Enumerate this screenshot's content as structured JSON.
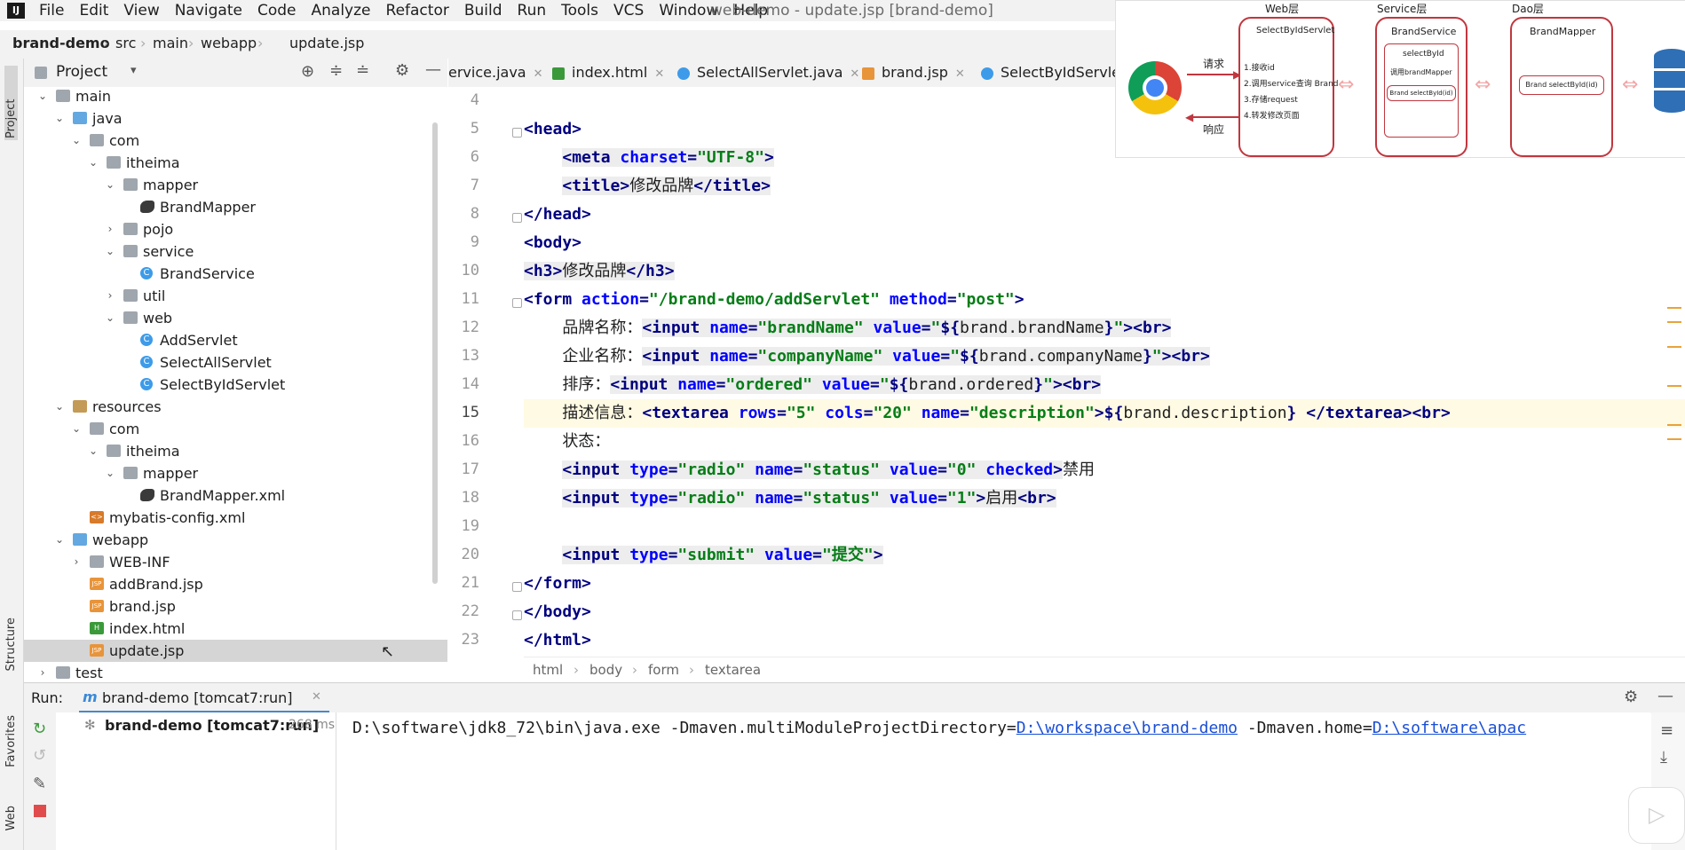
{
  "menu": {
    "items": [
      "File",
      "Edit",
      "View",
      "Navigate",
      "Code",
      "Analyze",
      "Refactor",
      "Build",
      "Run",
      "Tools",
      "VCS",
      "Window",
      "Help"
    ],
    "window_title": "web-demo - update.jsp [brand-demo]"
  },
  "breadcrumb": [
    "brand-demo",
    "src",
    "main",
    "webapp",
    "update.jsp"
  ],
  "left_stripe": {
    "project": "Project",
    "structure": "Structure",
    "favorites": "Favorites",
    "web": "Web"
  },
  "project_panel": {
    "title": "Project"
  },
  "tree": [
    {
      "label": "main",
      "depth": 3,
      "arrow": "down",
      "icon": "folder"
    },
    {
      "label": "java",
      "depth": 4,
      "arrow": "down",
      "icon": "folder-blue"
    },
    {
      "label": "com",
      "depth": 5,
      "arrow": "down",
      "icon": "folder"
    },
    {
      "label": "itheima",
      "depth": 6,
      "arrow": "down",
      "icon": "folder"
    },
    {
      "label": "mapper",
      "depth": 7,
      "arrow": "down",
      "icon": "folder"
    },
    {
      "label": "BrandMapper",
      "depth": 8,
      "arrow": "",
      "icon": "mybatis"
    },
    {
      "label": "pojo",
      "depth": 7,
      "arrow": "right",
      "icon": "folder"
    },
    {
      "label": "service",
      "depth": 7,
      "arrow": "down",
      "icon": "folder"
    },
    {
      "label": "BrandService",
      "depth": 8,
      "arrow": "",
      "icon": "class"
    },
    {
      "label": "util",
      "depth": 7,
      "arrow": "right",
      "icon": "folder"
    },
    {
      "label": "web",
      "depth": 7,
      "arrow": "down",
      "icon": "folder"
    },
    {
      "label": "AddServlet",
      "depth": 8,
      "arrow": "",
      "icon": "class"
    },
    {
      "label": "SelectAllServlet",
      "depth": 8,
      "arrow": "",
      "icon": "class"
    },
    {
      "label": "SelectByIdServlet",
      "depth": 8,
      "arrow": "",
      "icon": "class"
    },
    {
      "label": "resources",
      "depth": 4,
      "arrow": "down",
      "icon": "folder-res"
    },
    {
      "label": "com",
      "depth": 5,
      "arrow": "down",
      "icon": "folder"
    },
    {
      "label": "itheima",
      "depth": 6,
      "arrow": "down",
      "icon": "folder"
    },
    {
      "label": "mapper",
      "depth": 7,
      "arrow": "down",
      "icon": "folder"
    },
    {
      "label": "BrandMapper.xml",
      "depth": 8,
      "arrow": "",
      "icon": "mybatis"
    },
    {
      "label": "mybatis-config.xml",
      "depth": 5,
      "arrow": "",
      "icon": "xml"
    },
    {
      "label": "webapp",
      "depth": 4,
      "arrow": "down",
      "icon": "folder-blue"
    },
    {
      "label": "WEB-INF",
      "depth": 5,
      "arrow": "right",
      "icon": "folder"
    },
    {
      "label": "addBrand.jsp",
      "depth": 5,
      "arrow": "",
      "icon": "jsp"
    },
    {
      "label": "brand.jsp",
      "depth": 5,
      "arrow": "",
      "icon": "jsp"
    },
    {
      "label": "index.html",
      "depth": 5,
      "arrow": "",
      "icon": "html"
    },
    {
      "label": "update.jsp",
      "depth": 5,
      "arrow": "",
      "icon": "jsp",
      "selected": true
    },
    {
      "label": "test",
      "depth": 3,
      "arrow": "right",
      "icon": "folder"
    }
  ],
  "tabs": [
    {
      "label": "ervice.java",
      "icon": "class"
    },
    {
      "label": "index.html",
      "icon": "html"
    },
    {
      "label": "SelectAllServlet.java",
      "icon": "class"
    },
    {
      "label": "brand.jsp",
      "icon": "jsp"
    },
    {
      "label": "SelectByIdServlet.",
      "icon": "class"
    }
  ],
  "editor": {
    "line_numbers": [
      "4",
      "5",
      "6",
      "7",
      "8",
      "9",
      "10",
      "11",
      "12",
      "13",
      "14",
      "15",
      "16",
      "17",
      "18",
      "19",
      "20",
      "21",
      "22",
      "23"
    ],
    "current_line": "15",
    "breadcrumb": [
      "html",
      "body",
      "form",
      "textarea"
    ]
  },
  "run": {
    "label": "Run:",
    "tab": "brand-demo [tomcat7:run]",
    "node": "brand-demo [tomcat7:run]",
    "node_time": "268 ms",
    "console_prefix": "D:\\software\\jdk8_72\\bin\\java.exe -Dmaven.multiModuleProjectDirectory=",
    "console_link1": "D:\\workspace\\brand-demo",
    "console_mid": " -Dmaven.home=",
    "console_link2": "D:\\software\\apac"
  },
  "diagram": {
    "web_layer": "Web层",
    "service_layer": "Service层",
    "dao_layer": "Dao层",
    "servlet": "SelectByIdServlet",
    "request": "请求",
    "response": "响应",
    "steps": [
      "1.接收id",
      "2.调用service查询 Brand",
      "3.存储request",
      "4.转发修改页面"
    ],
    "brand_service": "BrandService",
    "select_by_id": "selectById",
    "call_mapper": "调用brandMapper",
    "service_method": "Brand selectById(id)",
    "brand_mapper": "BrandMapper",
    "mapper_method": "Brand selectById(id)",
    "colors": {
      "border": "#c0373f",
      "arrow": "#f2a7a7"
    }
  }
}
